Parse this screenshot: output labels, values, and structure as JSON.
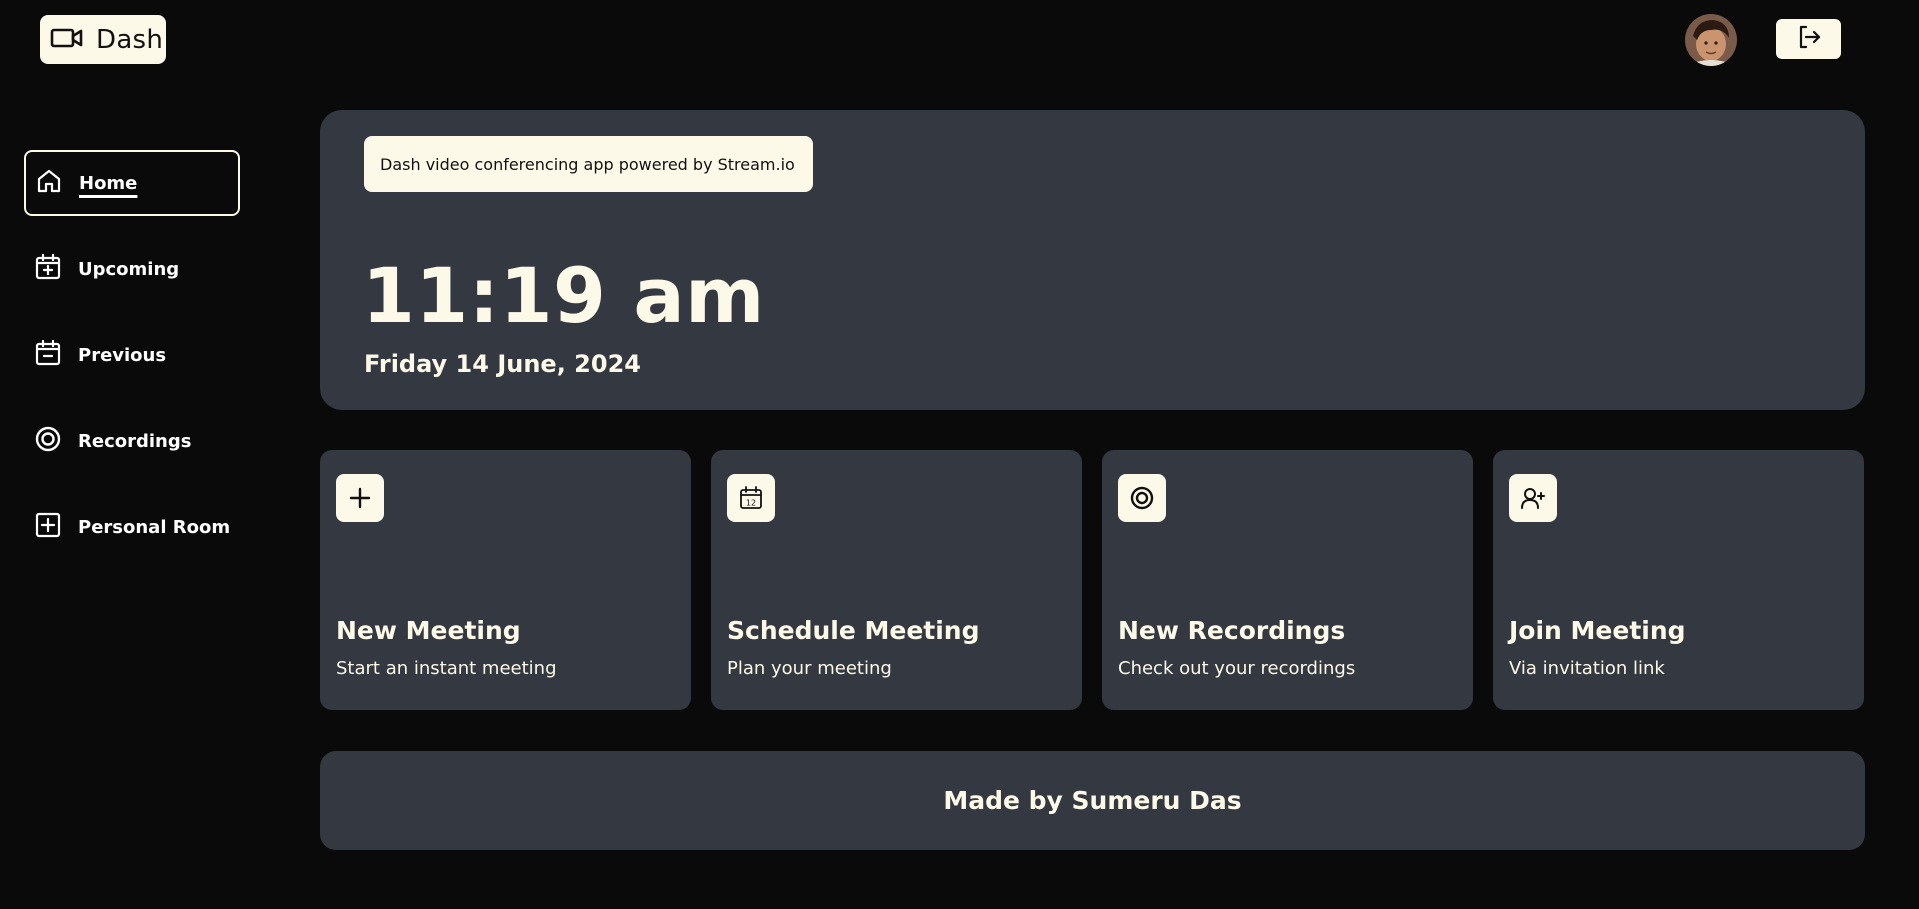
{
  "header": {
    "brand_name": "Dash",
    "brand_icon": "video-camera-icon",
    "avatar_alt": "user-avatar",
    "logout_icon": "logout-icon"
  },
  "sidebar": {
    "items": [
      {
        "label": "Home",
        "icon": "home-icon",
        "active": true
      },
      {
        "label": "Upcoming",
        "icon": "calendar-plus-icon",
        "active": false
      },
      {
        "label": "Previous",
        "icon": "calendar-minus-icon",
        "active": false
      },
      {
        "label": "Recordings",
        "icon": "record-icon",
        "active": false
      },
      {
        "label": "Personal Room",
        "icon": "plus-square-icon",
        "active": false
      }
    ]
  },
  "hero": {
    "tagline": "Dash video conferencing app powered by Stream.io",
    "time": "11:19 am",
    "date": "Friday 14 June, 2024"
  },
  "cards": [
    {
      "title": "New Meeting",
      "subtitle": "Start an instant meeting",
      "icon": "plus-icon"
    },
    {
      "title": "Schedule Meeting",
      "subtitle": "Plan your meeting",
      "icon": "calendar-icon"
    },
    {
      "title": "New Recordings",
      "subtitle": "Check out your recordings",
      "icon": "record-icon"
    },
    {
      "title": "Join Meeting",
      "subtitle": "Via invitation link",
      "icon": "user-plus-icon"
    }
  ],
  "footer": {
    "credit": "Made by Sumeru Das"
  },
  "colors": {
    "background": "#0a0a0a",
    "panel": "#343841",
    "cream": "#fdf9e8"
  }
}
